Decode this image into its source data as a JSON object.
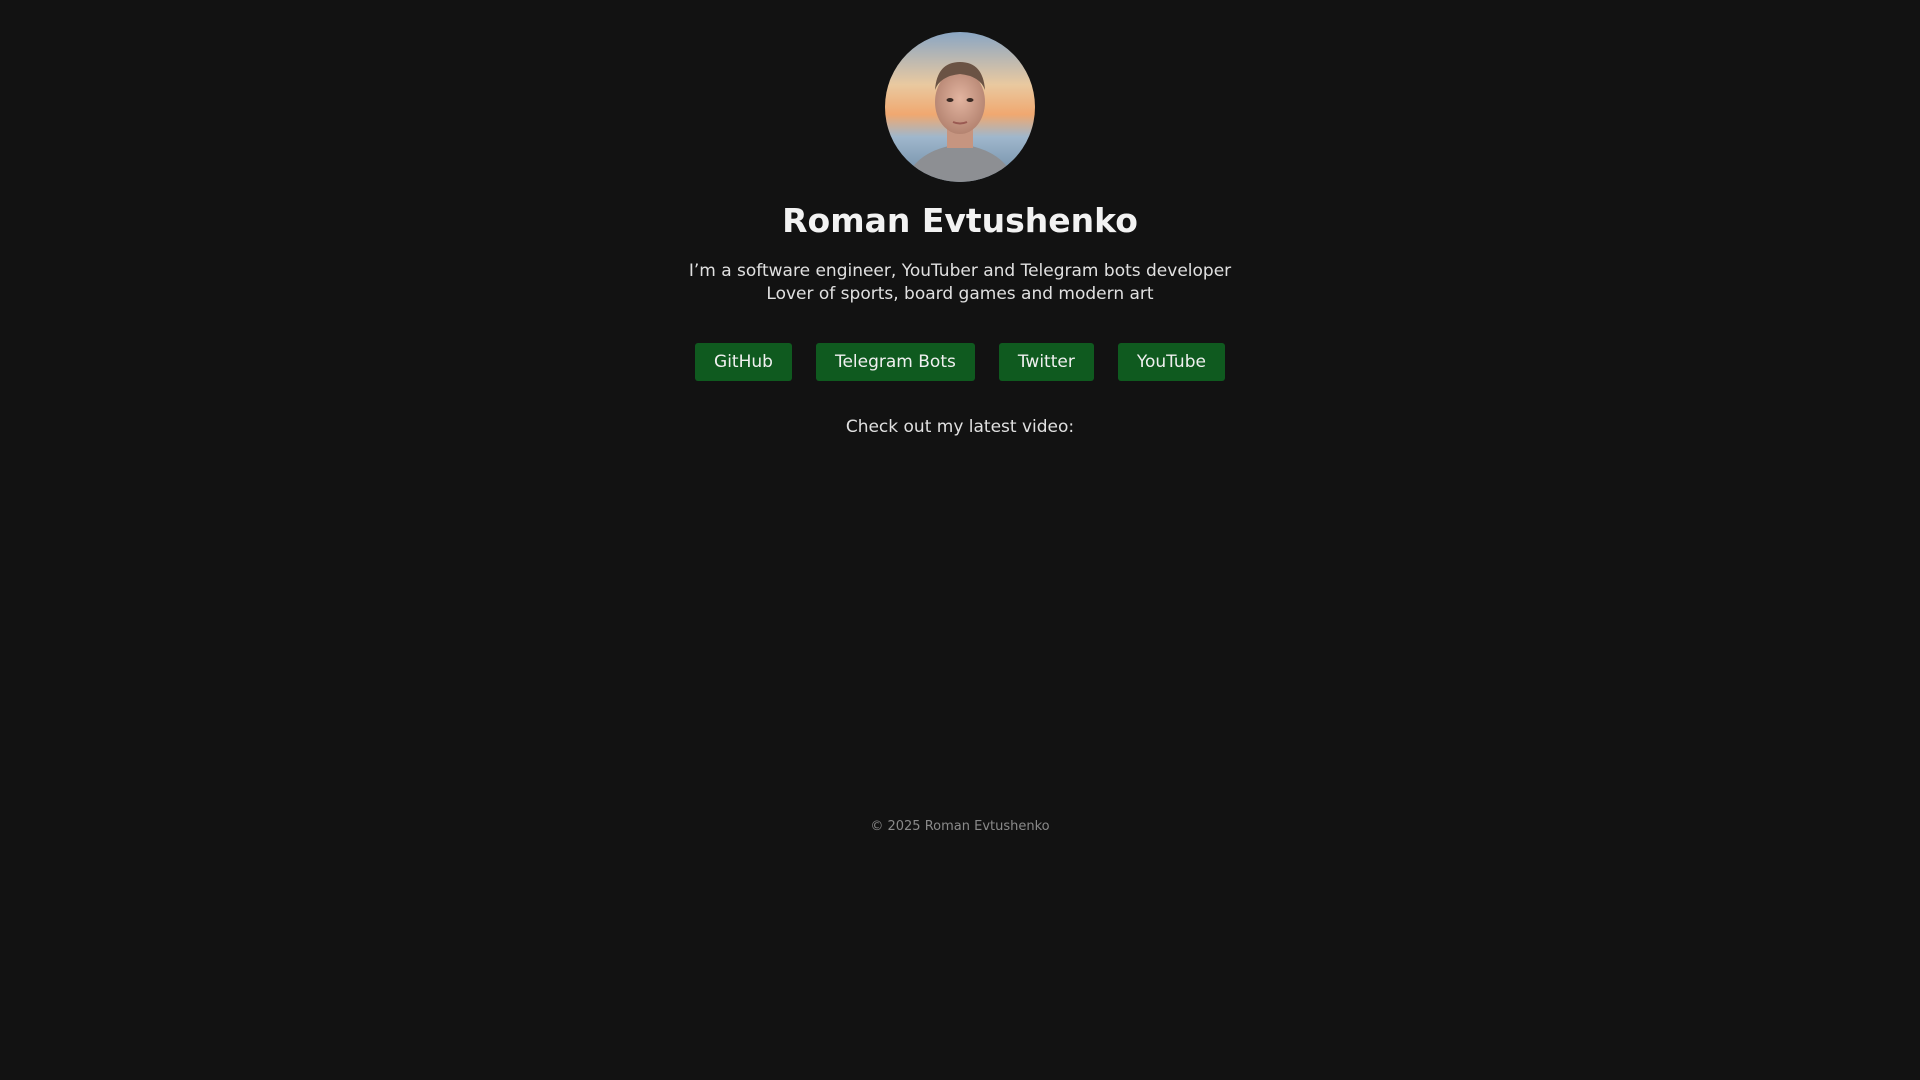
{
  "profile": {
    "name": "Roman Evtushenko",
    "avatar_icon": "profile-photo",
    "bio_line1": "I’m a software engineer, YouTuber and Telegram bots developer",
    "bio_line2": "Lover of sports, board games and modern art"
  },
  "links": [
    {
      "label": "GitHub"
    },
    {
      "label": "Telegram Bots"
    },
    {
      "label": "Twitter"
    },
    {
      "label": "YouTube"
    }
  ],
  "video": {
    "heading": "Check out my latest video:"
  },
  "footer": {
    "copyright": "© 2025 Roman Evtushenko"
  },
  "colors": {
    "background": "#121212",
    "button": "#0f5a1f",
    "text": "#e8e8e8",
    "footer_text": "#8a8a8a"
  }
}
